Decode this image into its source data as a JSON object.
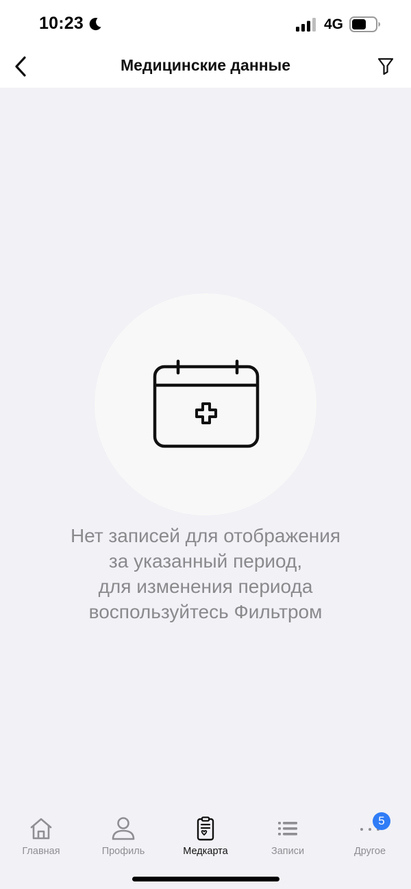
{
  "status_bar": {
    "time": "10:23",
    "network": "4G"
  },
  "nav": {
    "title": "Медицинские данные"
  },
  "empty_state": {
    "message": "Нет записей для отображения\nза указанный период,\nдля изменения периода\nвоспользуйтесь Фильтром"
  },
  "tabs": [
    {
      "label": "Главная",
      "icon": "home-icon",
      "active": false
    },
    {
      "label": "Профиль",
      "icon": "profile-icon",
      "active": false
    },
    {
      "label": "Медкарта",
      "icon": "medcard-icon",
      "active": true
    },
    {
      "label": "Записи",
      "icon": "list-icon",
      "active": false
    },
    {
      "label": "Другое",
      "icon": "more-icon",
      "active": false
    }
  ],
  "badge": {
    "count": "5"
  },
  "colors": {
    "background": "#f1f1f6",
    "badge": "#2f7cf6",
    "inactive_tab": "#8e8e93",
    "message_text": "#8a8a8d"
  }
}
